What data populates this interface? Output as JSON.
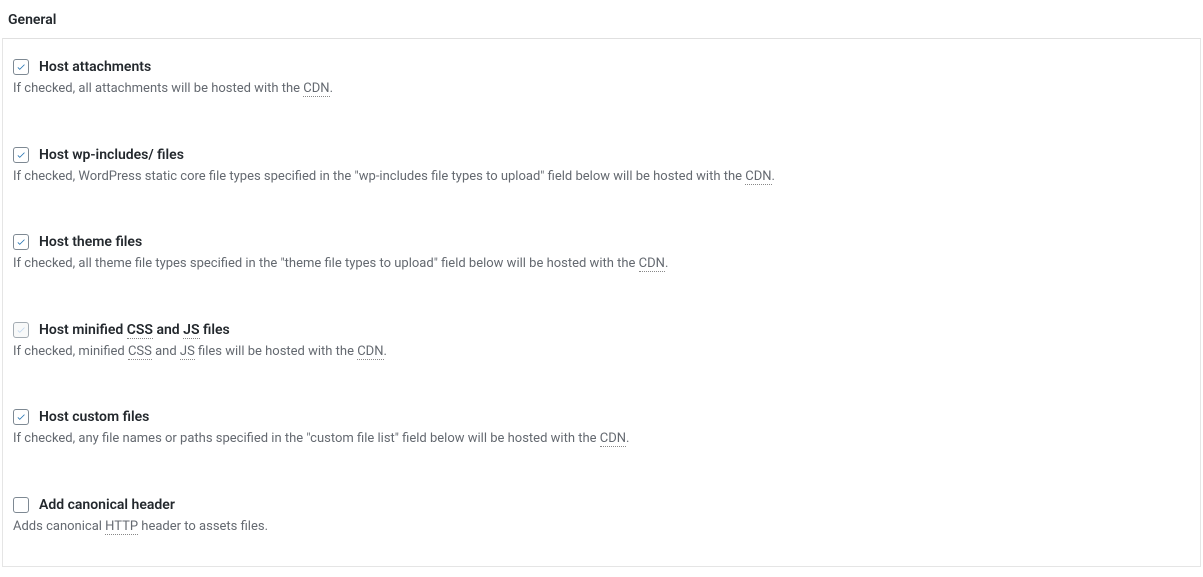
{
  "section_title": "General",
  "options": [
    {
      "checked": true,
      "disabled": false,
      "label": "Host attachments",
      "desc_before": "If checked, all attachments will be hosted with the ",
      "desc_abbr": "CDN",
      "desc_after": "."
    },
    {
      "checked": true,
      "disabled": false,
      "label": "Host wp-includes/ files",
      "desc_before": "If checked, WordPress static core file types specified in the \"wp-includes file types to upload\" field below will be hosted with the ",
      "desc_abbr": "CDN",
      "desc_after": "."
    },
    {
      "checked": true,
      "disabled": false,
      "label": "Host theme files",
      "desc_before": "If checked, all theme file types specified in the \"theme file types to upload\" field below will be hosted with the ",
      "desc_abbr": "CDN",
      "desc_after": "."
    },
    {
      "checked": true,
      "disabled": true,
      "label_parts": {
        "p1": "Host minified ",
        "a1": "CSS",
        "p2": " and ",
        "a2": "JS",
        "p3": " files"
      },
      "desc_parts": {
        "p1": "If checked, minified ",
        "a1": "CSS",
        "p2": " and ",
        "a2": "JS",
        "p3": " files will be hosted with the ",
        "a3": "CDN",
        "p4": "."
      }
    },
    {
      "checked": true,
      "disabled": false,
      "label": "Host custom files",
      "desc_before": "If checked, any file names or paths specified in the \"custom file list\" field below will be hosted with the ",
      "desc_abbr": "CDN",
      "desc_after": "."
    },
    {
      "checked": false,
      "disabled": false,
      "label": "Add canonical header",
      "desc_parts2": {
        "p1": "Adds canonical ",
        "a1": "HTTP",
        "p2": " header to assets files."
      }
    }
  ]
}
